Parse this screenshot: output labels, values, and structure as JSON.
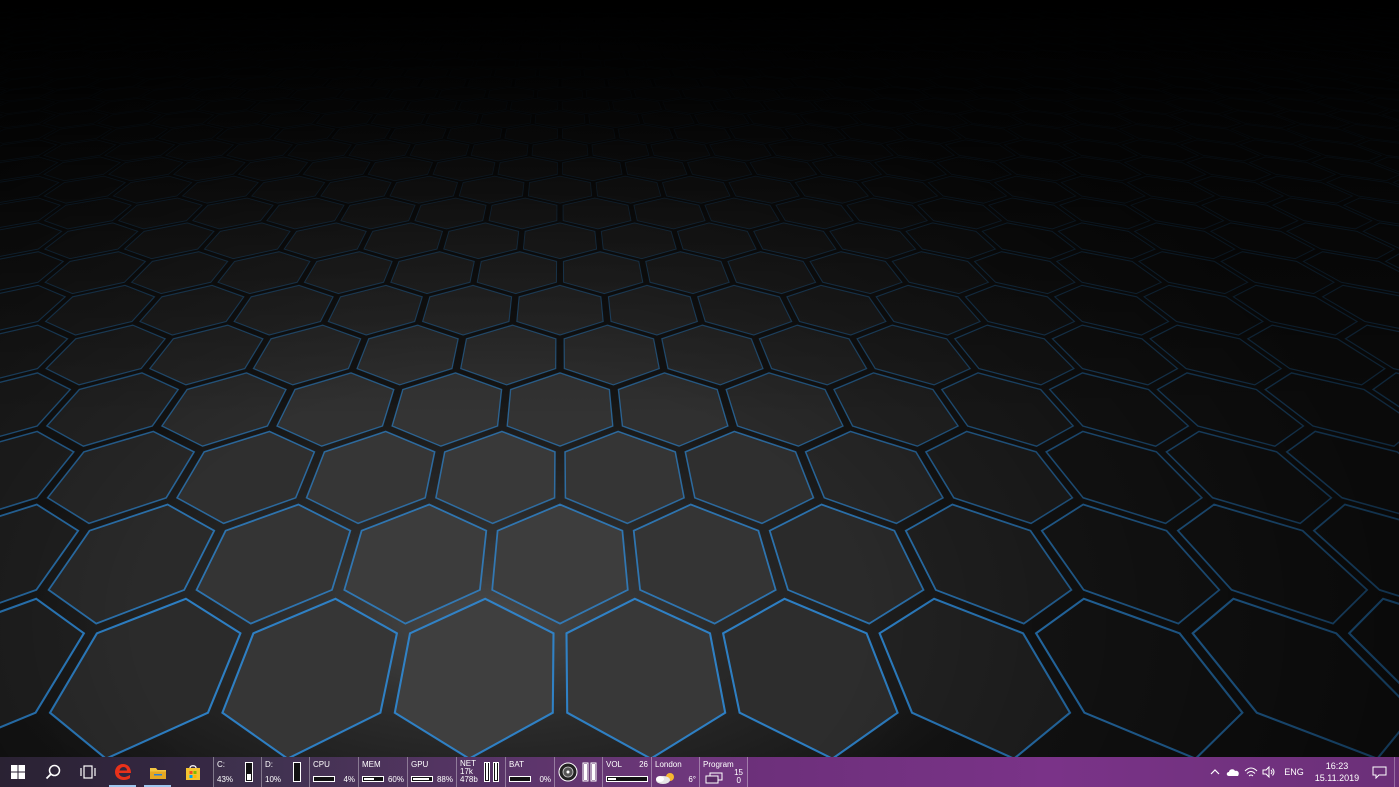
{
  "taskbar": {
    "apps": [
      {
        "name": "start-button",
        "icon": "windows-logo-icon"
      },
      {
        "name": "search-button",
        "icon": "search-icon"
      },
      {
        "name": "task-view-button",
        "icon": "task-view-icon"
      },
      {
        "name": "edge-button",
        "icon": "edge-icon",
        "active": true
      },
      {
        "name": "file-explorer-button",
        "icon": "folder-icon",
        "active": true
      },
      {
        "name": "store-button",
        "icon": "store-icon"
      }
    ],
    "meters": {
      "drive_c": {
        "label": "C:",
        "value": "43%",
        "level": 0.43
      },
      "drive_d": {
        "label": "D:",
        "value": "10%",
        "level": 0.1
      },
      "cpu": {
        "label": "CPU",
        "value": "4%",
        "level": 0.04
      },
      "mem": {
        "label": "MEM",
        "value": "60%",
        "level": 0.6
      },
      "gpu": {
        "label": "GPU",
        "value": "88%",
        "level": 0.88
      },
      "net": {
        "label": "NET",
        "down": "17k",
        "up": "478b"
      },
      "bat": {
        "label": "BAT",
        "value": "0%",
        "level": 0.0
      },
      "vol": {
        "label": "VOL",
        "value": "26",
        "level": 0.26
      },
      "weather": {
        "label": "London",
        "value": "6°"
      },
      "program": {
        "label": "Program",
        "value_top": "15",
        "value_bottom": "0"
      }
    },
    "tray": {
      "language": "ENG",
      "time": "16:23",
      "date": "15.11.2019"
    }
  },
  "colors": {
    "accent_blue": "#2f8fe0",
    "taskbar_purple": "#7a3388"
  }
}
